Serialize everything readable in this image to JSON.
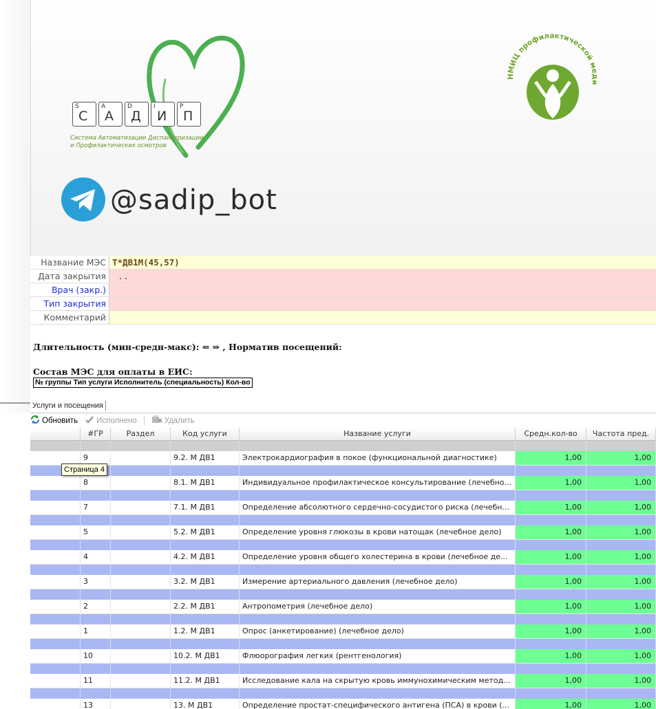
{
  "banner": {
    "system_keys": [
      {
        "small": "S",
        "big": "С"
      },
      {
        "small": "A",
        "big": "А"
      },
      {
        "small": "D",
        "big": "Д"
      },
      {
        "small": "I",
        "big": "И"
      },
      {
        "small": "P",
        "big": "П"
      }
    ],
    "system_caption_line1": "Система Автоматизации Диспансеризации",
    "system_caption_line2": "и Профилактических осмотров",
    "org_logo_text": "НМИЦ профилактической медицины",
    "bot_name": "@sadip_bot",
    "colors": {
      "heart": "#4caf50",
      "org": "#6fa830",
      "telegram": "#2a9fd8"
    }
  },
  "form": {
    "name_label": "Название МЭС",
    "name_value": "Т*ДВ1М(45,57)",
    "close_date_label": "Дата закрытия",
    "close_date_value": ". .",
    "doctor_label": "Врач (закр.)",
    "doctor_value": "",
    "close_type_label": "Тип закрытия",
    "close_type_value": "",
    "comment_label": "Комментарий",
    "comment_value": ""
  },
  "duration_text": "Длительность (мин-средн-макс): ⇐ ⇒ , Норматив посещений:",
  "composition_title": "Состав МЭС для оплаты в ЕИС:",
  "composition_header": "№ группы Тип услуги Исполнитель (специальность) Кол-во",
  "tab_label": "Услуги и посещения",
  "toolbar": {
    "refresh_label": "Обновить",
    "done_label": "Исполнено",
    "delete_label": "Удалить"
  },
  "grid": {
    "columns": [
      "",
      "#ГР",
      "Раздел",
      "Код услуги",
      "Название услуги",
      "Средн.кол-во",
      "Частота пред."
    ],
    "rows": [
      {
        "gr": "9",
        "section": "",
        "code": "9.2. М ДВ1",
        "name": "Электрокардиография в покое (функциональной диагностике)",
        "avg": "1,00",
        "freq": "1,00"
      },
      {
        "gr": "8",
        "section": "",
        "code": "8.1. М ДВ1",
        "name": "Индивидуальное профилактическое консультирование (лечебно...",
        "avg": "1,00",
        "freq": "1,00"
      },
      {
        "gr": "7",
        "section": "",
        "code": "7.1. М ДВ1",
        "name": "Определение абсолютного сердечно-сосудистого риска (лечебн...",
        "avg": "1,00",
        "freq": "1,00"
      },
      {
        "gr": "5",
        "section": "",
        "code": "5.2. М ДВ1",
        "name": "Определение уровня глюкозы в крови натощак (лечебное дело)",
        "avg": "1,00",
        "freq": "1,00"
      },
      {
        "gr": "4",
        "section": "",
        "code": "4.2. М ДВ1",
        "name": "Определение уровня общего холестерина в крови (лечебное де...",
        "avg": "1,00",
        "freq": "1,00"
      },
      {
        "gr": "3",
        "section": "",
        "code": "3.2. М ДВ1",
        "name": "Измерение артериального давления (лечебное дело)",
        "avg": "1,00",
        "freq": "1,00"
      },
      {
        "gr": "2",
        "section": "",
        "code": "2.2. М ДВ1",
        "name": "Антропометрия (лечебное дело)",
        "avg": "1,00",
        "freq": "1,00"
      },
      {
        "gr": "1",
        "section": "",
        "code": "1.2. М ДВ1",
        "name": "Опрос (анкетирование) (лечебное дело)",
        "avg": "1,00",
        "freq": "1,00"
      },
      {
        "gr": "10",
        "section": "",
        "code": "10.2. М ДВ1",
        "name": "Флюорография легких (рентгенология)",
        "avg": "1,00",
        "freq": "1,00"
      },
      {
        "gr": "11",
        "section": "",
        "code": "11.2. М ДВ1",
        "name": "Исследование кала на скрытую кровь иммунохимическим метод...",
        "avg": "1,00",
        "freq": "1,00"
      },
      {
        "gr": "13",
        "section": "",
        "code": "13. М ДВ1",
        "name": "Определение простат-специфического антигена (ПСА) в крови (...",
        "avg": "1,00",
        "freq": "1,00"
      }
    ]
  },
  "tooltip_text": "Страница 4"
}
